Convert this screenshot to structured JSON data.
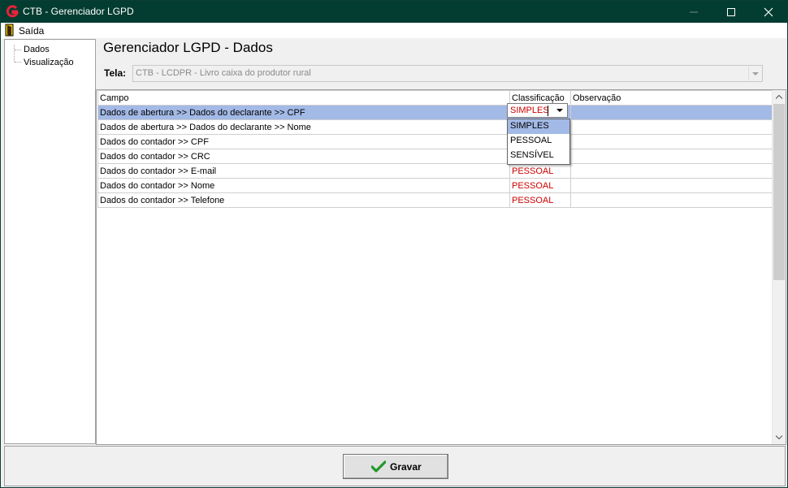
{
  "window": {
    "title": "CTB - Gerenciador LGPD",
    "icons": [
      "app-logo-icon",
      "minimize-icon",
      "maximize-icon",
      "close-icon"
    ]
  },
  "menu": {
    "exit_label": "Saída",
    "exit_icon": "door-exit-icon"
  },
  "tree": {
    "items": [
      {
        "label": "Dados"
      },
      {
        "label": "Visualização"
      }
    ]
  },
  "page": {
    "heading": "Gerenciador LGPD - Dados",
    "tela_label": "Tela:",
    "tela_value": "CTB - LCDPR - Livro caixa do produtor rural"
  },
  "grid": {
    "headers": {
      "campo": "Campo",
      "classificacao": "Classificação",
      "observacao": "Observação"
    },
    "rows": [
      {
        "campo": "Dados de abertura >>  Dados do declarante  >> CPF",
        "classificacao": "",
        "observacao": ""
      },
      {
        "campo": "Dados de abertura >>  Dados do declarante  >> Nome",
        "classificacao": "",
        "observacao": ""
      },
      {
        "campo": "Dados do contador >> CPF",
        "classificacao": "",
        "observacao": ""
      },
      {
        "campo": "Dados do contador >> CRC",
        "classificacao": "",
        "observacao": ""
      },
      {
        "campo": "Dados do contador >> E-mail",
        "classificacao": "PESSOAL",
        "observacao": ""
      },
      {
        "campo": "Dados do contador >> Nome",
        "classificacao": "PESSOAL",
        "observacao": ""
      },
      {
        "campo": "Dados do contador >> Telefone",
        "classificacao": "PESSOAL",
        "observacao": ""
      }
    ]
  },
  "editor": {
    "value": "SIMPLES",
    "options": [
      "SIMPLES",
      "PESSOAL",
      "SENSÍVEL"
    ],
    "highlighted": "SIMPLES"
  },
  "footer": {
    "save_label": "Gravar",
    "save_icon": "checkmark-icon"
  },
  "colors": {
    "titlebar": "#033d31",
    "selection": "#a3b9e6",
    "classification_text": "#cc0000"
  }
}
